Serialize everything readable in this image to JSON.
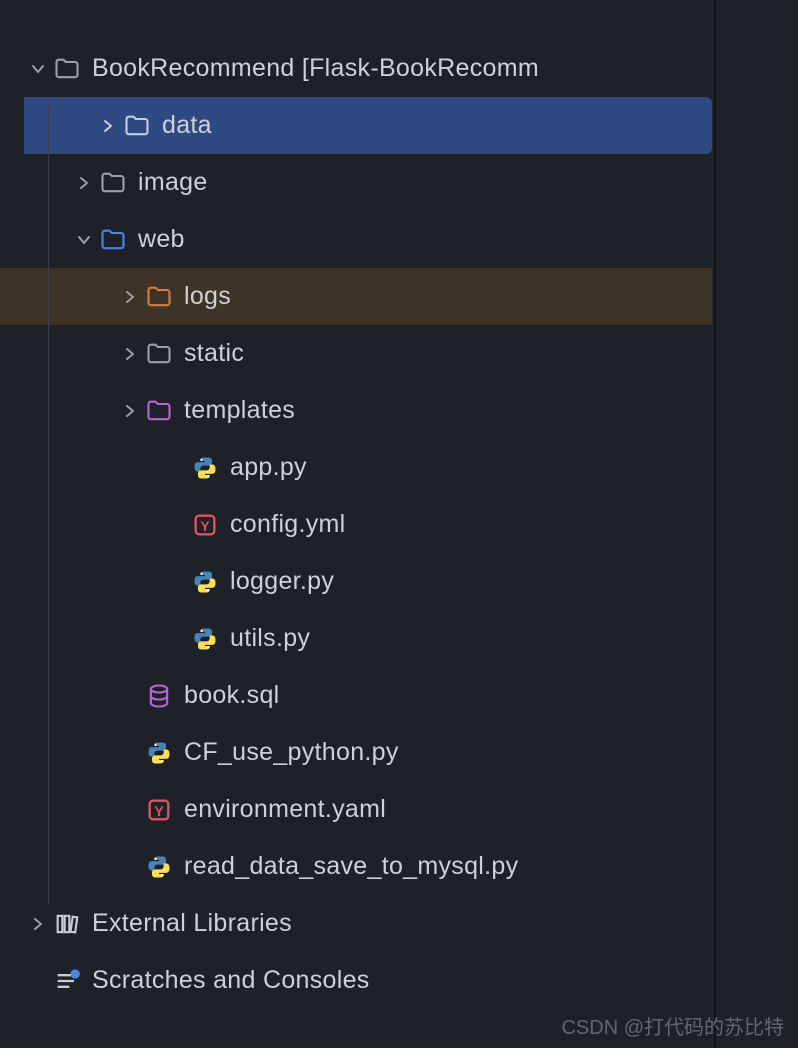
{
  "project": {
    "name": "BookRecommend",
    "suffix": " [Flask-BookRecomm"
  },
  "nodes": {
    "data": "data",
    "image": "image",
    "web": "web",
    "logs": "logs",
    "static": "static",
    "templates": "templates",
    "app_py": "app.py",
    "config_yml": "config.yml",
    "logger_py": "logger.py",
    "utils_py": "utils.py",
    "book_sql": "book.sql",
    "cf_py": "CF_use_python.py",
    "env_yaml": "environment.yaml",
    "read_data_py": "read_data_save_to_mysql.py",
    "ext_libs": "External Libraries",
    "scratches": "Scratches and Consoles"
  },
  "watermark": "CSDN @打代码的苏比特"
}
